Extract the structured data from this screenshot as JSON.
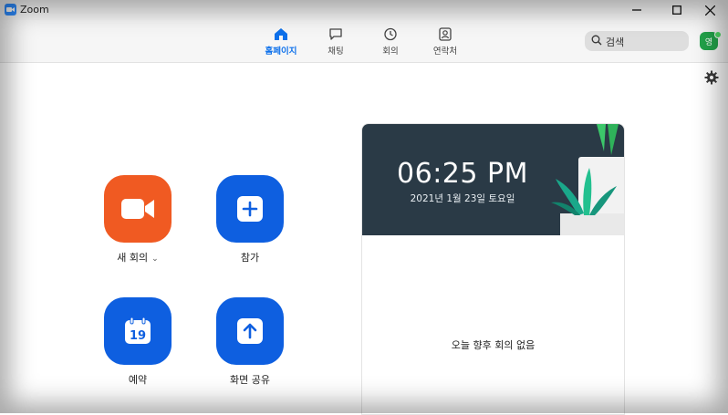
{
  "window": {
    "title": "Zoom"
  },
  "tabs": [
    {
      "label": "홈페이지",
      "icon": "home-icon",
      "active": true
    },
    {
      "label": "채팅",
      "icon": "chat-icon",
      "active": false
    },
    {
      "label": "회의",
      "icon": "clock-icon",
      "active": false
    },
    {
      "label": "연락처",
      "icon": "contacts-icon",
      "active": false
    }
  ],
  "search": {
    "text": "검색"
  },
  "user": {
    "initials": "영",
    "status_color": "#4cd964"
  },
  "actions": {
    "new_meeting": {
      "label": "새 회의",
      "color": "#f05a22",
      "icon": "video-camera-icon"
    },
    "join": {
      "label": "참가",
      "color": "#0e5fe0",
      "icon": "plus-icon"
    },
    "schedule": {
      "label": "예약",
      "color": "#0e5fe0",
      "icon": "calendar-icon",
      "calendar_day": "19"
    },
    "share_screen": {
      "label": "화면 공유",
      "color": "#0e5fe0",
      "icon": "share-up-arrow-icon"
    }
  },
  "meeting_panel": {
    "time": "06:25 PM",
    "date": "2021년 1월 23일 토요일",
    "empty_message": "오늘 향후 회의 없음"
  },
  "colors": {
    "accent": "#0e71eb",
    "panel_header": "#2a3a46"
  }
}
